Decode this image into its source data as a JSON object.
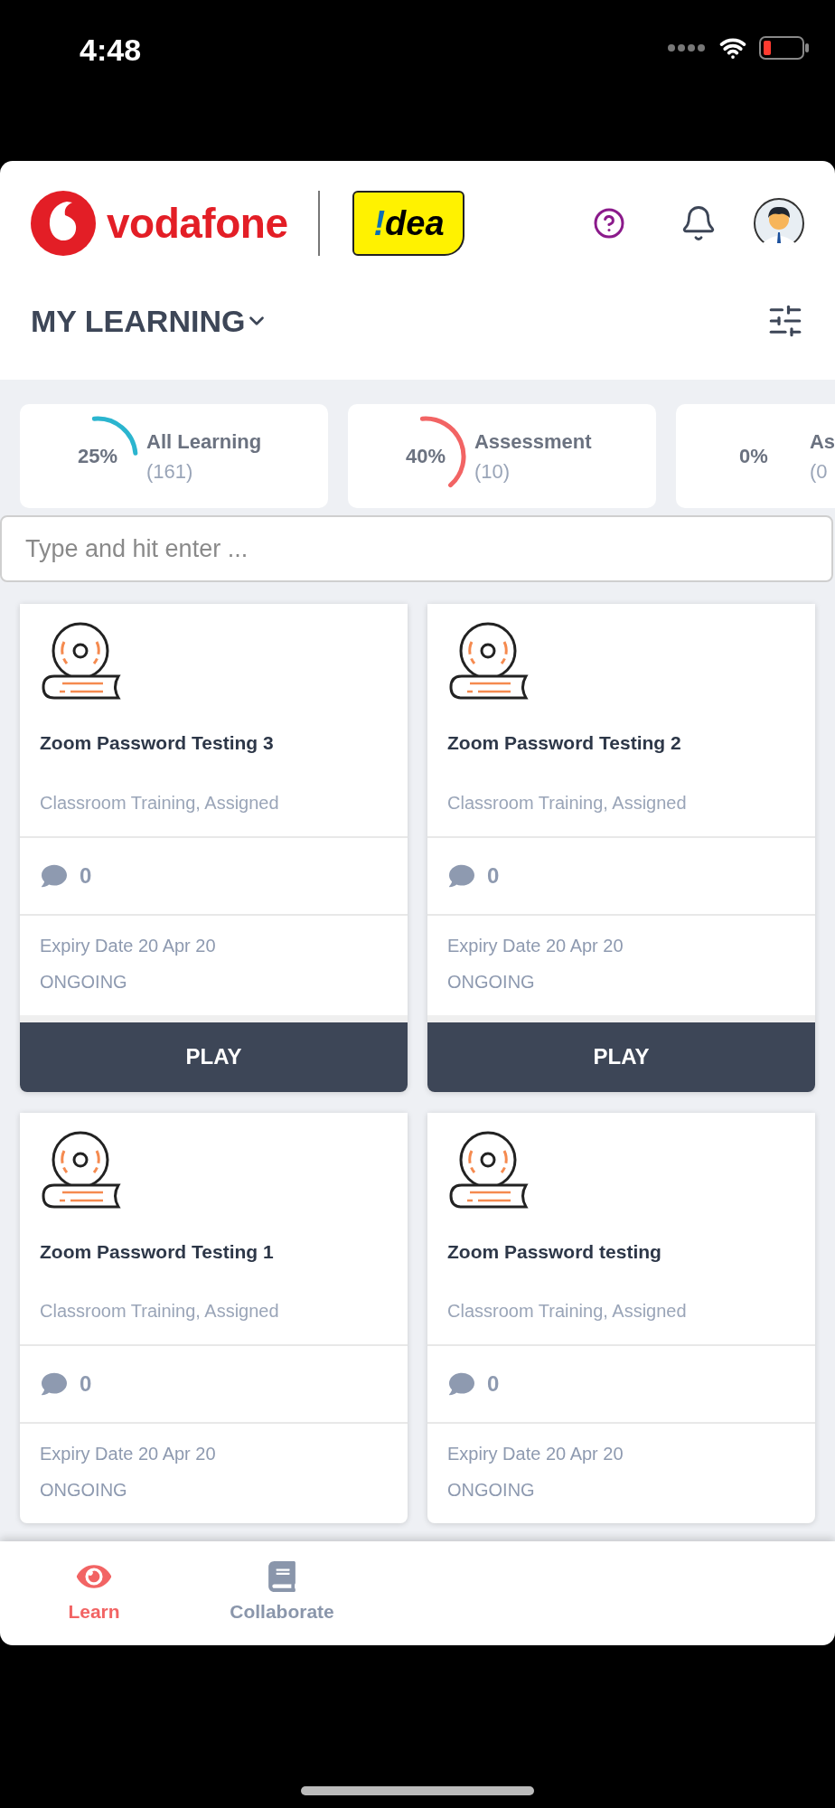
{
  "status_bar": {
    "time": "4:48"
  },
  "header": {
    "brand": "vodafone",
    "idea_logo": {
      "mark": "!",
      "text": "dea"
    },
    "title": "MY LEARNING"
  },
  "stats": [
    {
      "percent": "25%",
      "color": "#2bb5cf",
      "label": "All Learning",
      "count": "(161)"
    },
    {
      "percent": "40%",
      "color": "#f26464",
      "label": "Assessment",
      "count": "(10)"
    },
    {
      "percent": "0%",
      "label": "As",
      "count": "(0"
    }
  ],
  "search": {
    "placeholder": "Type and hit enter ..."
  },
  "courses": [
    {
      "title": "Zoom Password Testing 3",
      "meta": "Classroom Training, Assigned",
      "comments": "0",
      "expiry": "Expiry Date 20 Apr 20",
      "status": "ONGOING",
      "button": "PLAY"
    },
    {
      "title": "Zoom Password Testing 2",
      "meta": "Classroom Training, Assigned",
      "comments": "0",
      "expiry": "Expiry Date 20 Apr 20",
      "status": "ONGOING",
      "button": "PLAY"
    },
    {
      "title": "Zoom Password Testing 1",
      "meta": "Classroom Training, Assigned",
      "comments": "0",
      "expiry": "Expiry Date 20 Apr 20",
      "status": "ONGOING"
    },
    {
      "title": "Zoom Password testing",
      "meta": "Classroom Training, Assigned",
      "comments": "0",
      "expiry": "Expiry Date 20 Apr 20",
      "status": "ONGOING"
    }
  ],
  "bottom_nav": [
    {
      "label": "Learn",
      "kind": "eye",
      "selected": true
    },
    {
      "label": "Collaborate",
      "kind": "book",
      "selected": false
    }
  ]
}
